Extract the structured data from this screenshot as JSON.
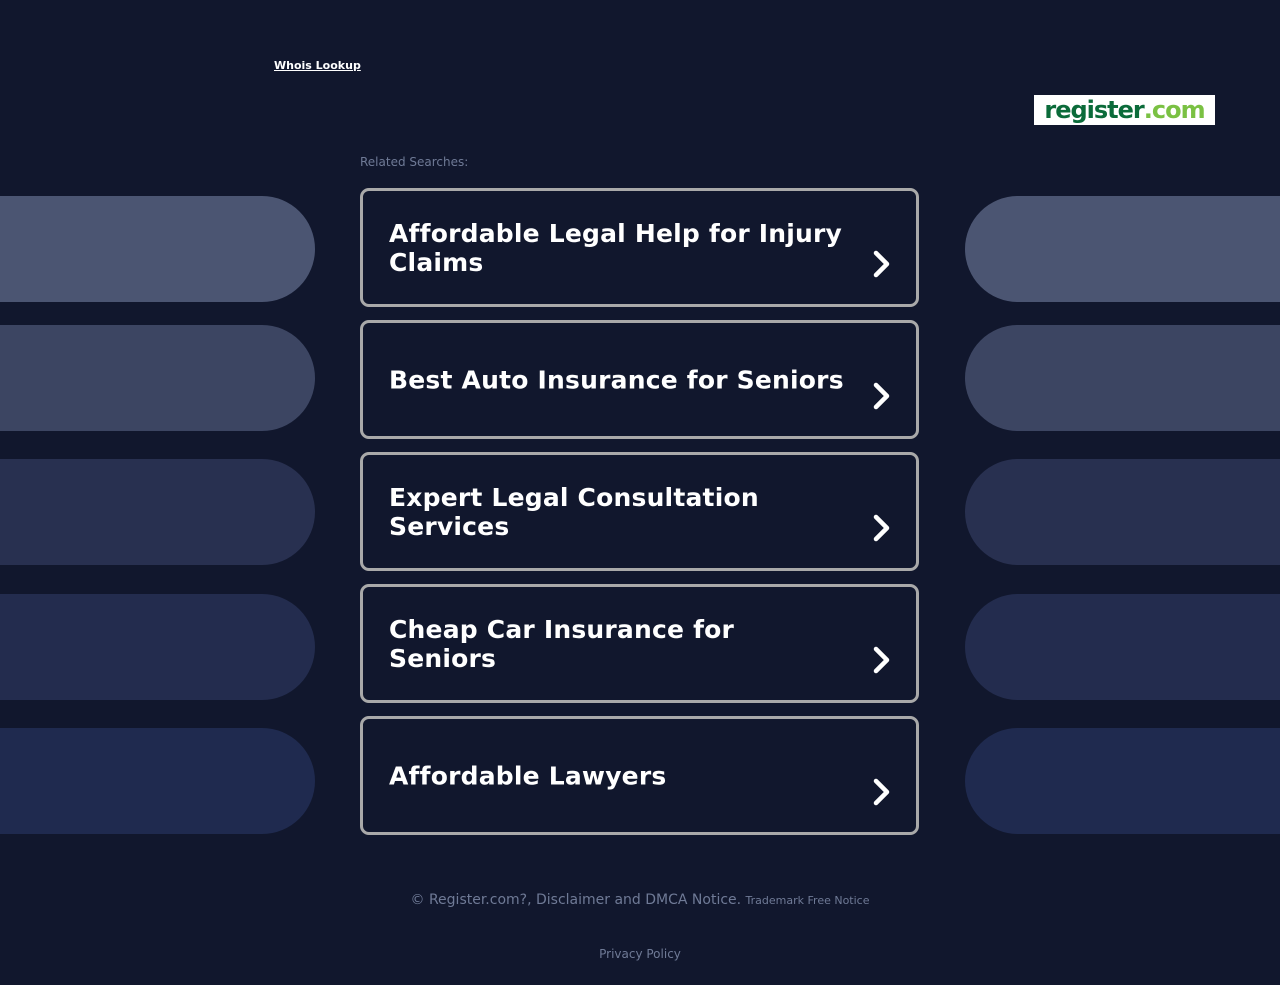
{
  "header": {
    "whois_label": "Whois Lookup"
  },
  "logo": {
    "part1": "register",
    "part2": ".com"
  },
  "related": {
    "label": "Related Searches:"
  },
  "results": [
    {
      "title": "Affordable Legal Help for Injury Claims"
    },
    {
      "title": "Best Auto Insurance for Seniors"
    },
    {
      "title": "Expert Legal Consultation Services"
    },
    {
      "title": "Cheap Car Insurance for Seniors"
    },
    {
      "title": "Affordable Lawyers"
    }
  ],
  "footer": {
    "copyright": "© Register.com?, Disclaimer and DMCA Notice.",
    "trademark": "Trademark Free Notice",
    "privacy": "Privacy Policy"
  },
  "colors": {
    "background": "#11172d",
    "card_border": "#a9a9a9",
    "pill_1": "#4b5572",
    "pill_2": "#3c4562",
    "pill_3": "#283050",
    "pill_4": "#232c4e",
    "pill_5": "#1f2a4f",
    "logo_green_dark": "#0b6b3a",
    "logo_green_light": "#7ac143"
  }
}
